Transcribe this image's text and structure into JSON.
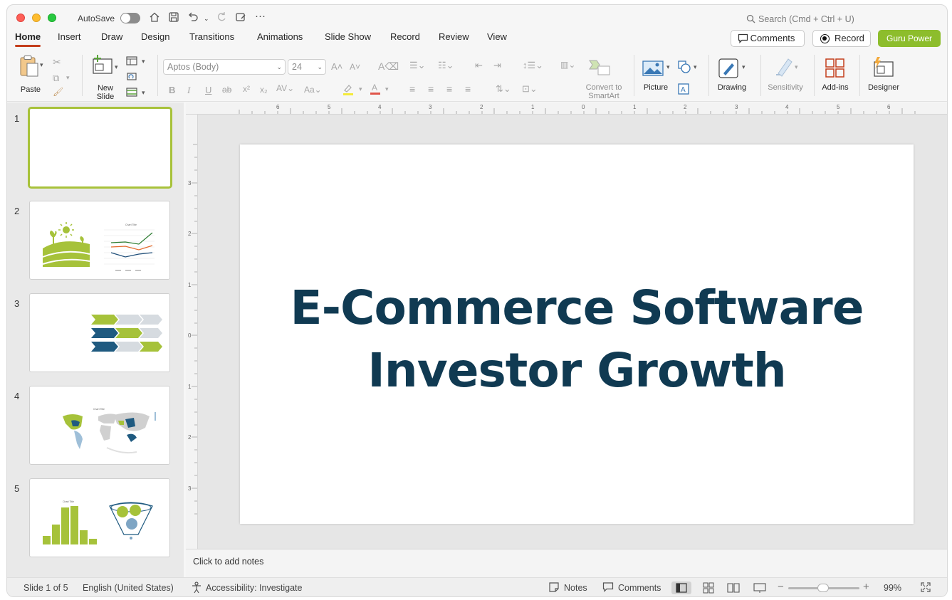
{
  "titlebar": {
    "autosave_label": "AutoSave",
    "search_placeholder": "Search (Cmd + Ctrl + U)"
  },
  "tabs": [
    "Home",
    "Insert",
    "Draw",
    "Design",
    "Transitions",
    "Animations",
    "Slide Show",
    "Record",
    "Review",
    "View"
  ],
  "actions": {
    "comments": "Comments",
    "record": "Record",
    "guru": "Guru Power"
  },
  "ribbon": {
    "paste": "Paste",
    "new_slide_1": "New",
    "new_slide_2": "Slide",
    "font_name": "Aptos (Body)",
    "font_size": "24",
    "convert_1": "Convert to",
    "convert_2": "SmartArt",
    "picture": "Picture",
    "drawing": "Drawing",
    "sensitivity": "Sensitivity",
    "addins": "Add-ins",
    "designer": "Designer"
  },
  "thumbnails": [
    {
      "num": "1"
    },
    {
      "num": "2"
    },
    {
      "num": "3"
    },
    {
      "num": "4"
    },
    {
      "num": "5"
    }
  ],
  "slide": {
    "title_line1": "E-Commerce Software",
    "title_line2": "Investor Growth"
  },
  "notes_placeholder": "Click to add notes",
  "status": {
    "slide_info": "Slide 1 of 5",
    "language": "English (United States)",
    "accessibility": "Accessibility: Investigate",
    "notes": "Notes",
    "comments": "Comments",
    "zoom": "99%"
  },
  "colors": {
    "accent_green": "#8dbd2c",
    "title_navy": "#103a52",
    "active_tab_underline": "#c43e1c"
  }
}
